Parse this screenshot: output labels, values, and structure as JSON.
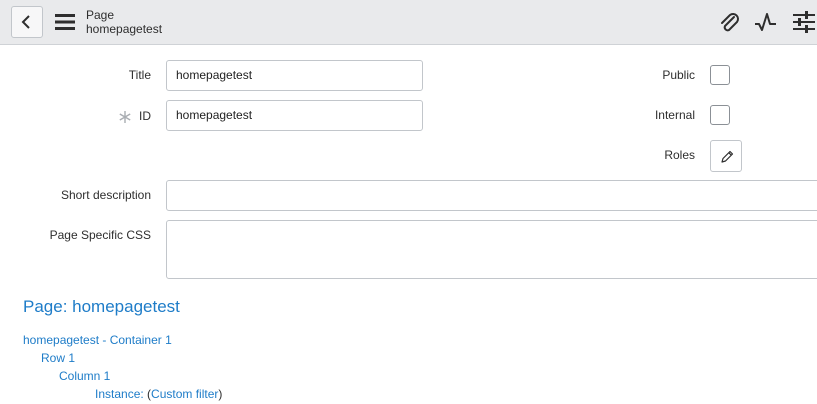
{
  "header": {
    "title": "Page",
    "subtitle": "homepagetest",
    "icons": [
      "back-chevron-icon",
      "hamburger-menu-icon",
      "paperclip-icon",
      "activity-icon",
      "settings-sliders-icon"
    ]
  },
  "form": {
    "title_label": "Title",
    "title_value": "homepagetest",
    "id_label": "ID",
    "id_value": "homepagetest",
    "public_label": "Public",
    "internal_label": "Internal",
    "roles_label": "Roles",
    "short_description_label": "Short description",
    "short_description_value": "",
    "page_css_label": "Page Specific CSS",
    "page_css_value": ""
  },
  "structure": {
    "heading": "Page: homepagetest",
    "container": "homepagetest - Container 1",
    "row": "Row 1",
    "column": "Column 1",
    "instance_label": "Instance:",
    "instance_open": "(",
    "instance_link": "Custom filter",
    "instance_close": ")"
  },
  "colors": {
    "link": "#1e7cc8",
    "header_bg": "#e9eaec"
  }
}
